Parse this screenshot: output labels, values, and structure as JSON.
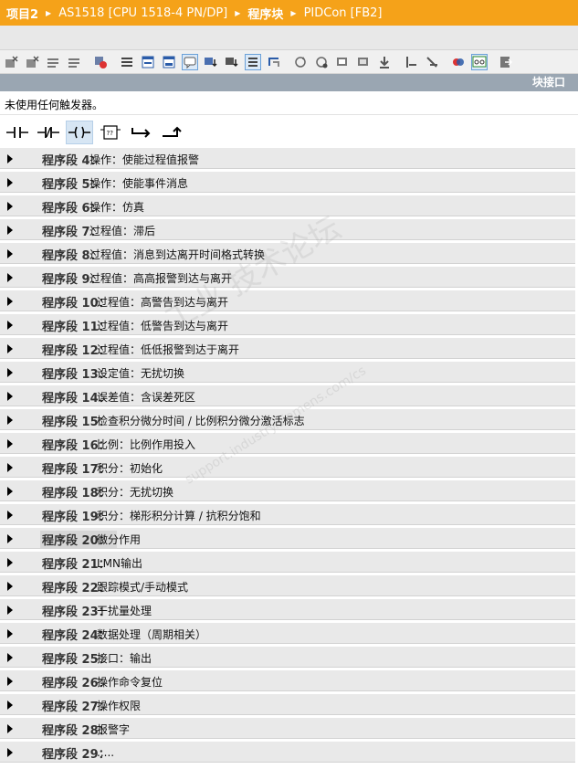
{
  "breadcrumb": [
    "项目2",
    "AS1518 [CPU 1518-4 PN/DP]",
    "程序块",
    "PIDCon [FB2]"
  ],
  "interface_label": "块接口",
  "trigger_text": "未使用任何触发器。",
  "watermark": "工业  技术论坛",
  "watermark_url": "support.industry.siemens.com/cs",
  "toolbar_icons": [
    "cpu-x-icon",
    "cpu-x2-icon",
    "insert-rows-icon",
    "delete-rows-icon",
    "call-icon",
    "list-icon",
    "window-icon",
    "window2-icon",
    "comment-icon",
    "tag-download-icon",
    "monitor-icon",
    "list-active-icon",
    "step-icon",
    "refresh-icon",
    "arrow-reset-icon",
    "view-icon",
    "view2-icon",
    "download-icon",
    "bar-icon",
    "bar2-icon",
    "compare-icon",
    "glasses-icon",
    "export-icon"
  ],
  "ladder_icons": [
    "no-contact-icon",
    "nc-contact-icon",
    "coil-icon",
    "box-icon",
    "branch-open-icon",
    "branch-close-icon"
  ],
  "networks": [
    {
      "label": "程序段 4：",
      "title": "操作：使能过程值报警"
    },
    {
      "label": "程序段 5：",
      "title": "操作：使能事件消息"
    },
    {
      "label": "程序段 6：",
      "title": "操作：仿真"
    },
    {
      "label": "程序段 7：",
      "title": "过程值：滞后"
    },
    {
      "label": "程序段 8：",
      "title": "过程值：消息到达离开时间格式转换"
    },
    {
      "label": "程序段 9：",
      "title": "过程值：高高报警到达与离开"
    },
    {
      "label": "程序段 10：",
      "title": "过程值：高警告到达与离开"
    },
    {
      "label": "程序段 11：",
      "title": "过程值：低警告到达与离开"
    },
    {
      "label": "程序段 12：",
      "title": "过程值：低低报警到达于离开"
    },
    {
      "label": "程序段 13：",
      "title": "设定值：无扰切换"
    },
    {
      "label": "程序段 14：",
      "title": "误差值：含误差死区"
    },
    {
      "label": "程序段 15：",
      "title": "检查积分微分时间 / 比例积分微分激活标志"
    },
    {
      "label": "程序段 16：",
      "title": "比例：比例作用投入"
    },
    {
      "label": "程序段 17：",
      "title": "积分：初始化"
    },
    {
      "label": "程序段 18：",
      "title": "积分：无扰切换"
    },
    {
      "label": "程序段 19：",
      "title": "积分：梯形积分计算 / 抗积分饱和"
    },
    {
      "label": "程序段 20：",
      "title": "微分作用"
    },
    {
      "label": "程序段 21：",
      "title": "LMN输出"
    },
    {
      "label": "程序段 22：",
      "title": "跟踪模式/手动模式"
    },
    {
      "label": "程序段 23：",
      "title": "干扰量处理"
    },
    {
      "label": "程序段 24：",
      "title": "数据处理（周期相关）"
    },
    {
      "label": "程序段 25：",
      "title": "接口：输出"
    },
    {
      "label": "程序段 26：",
      "title": "操作命令复位"
    },
    {
      "label": "程序段 27：",
      "title": "操作权限"
    },
    {
      "label": "程序段 28：",
      "title": "报警字"
    },
    {
      "label": "程序段 29：",
      "title": "....."
    }
  ]
}
